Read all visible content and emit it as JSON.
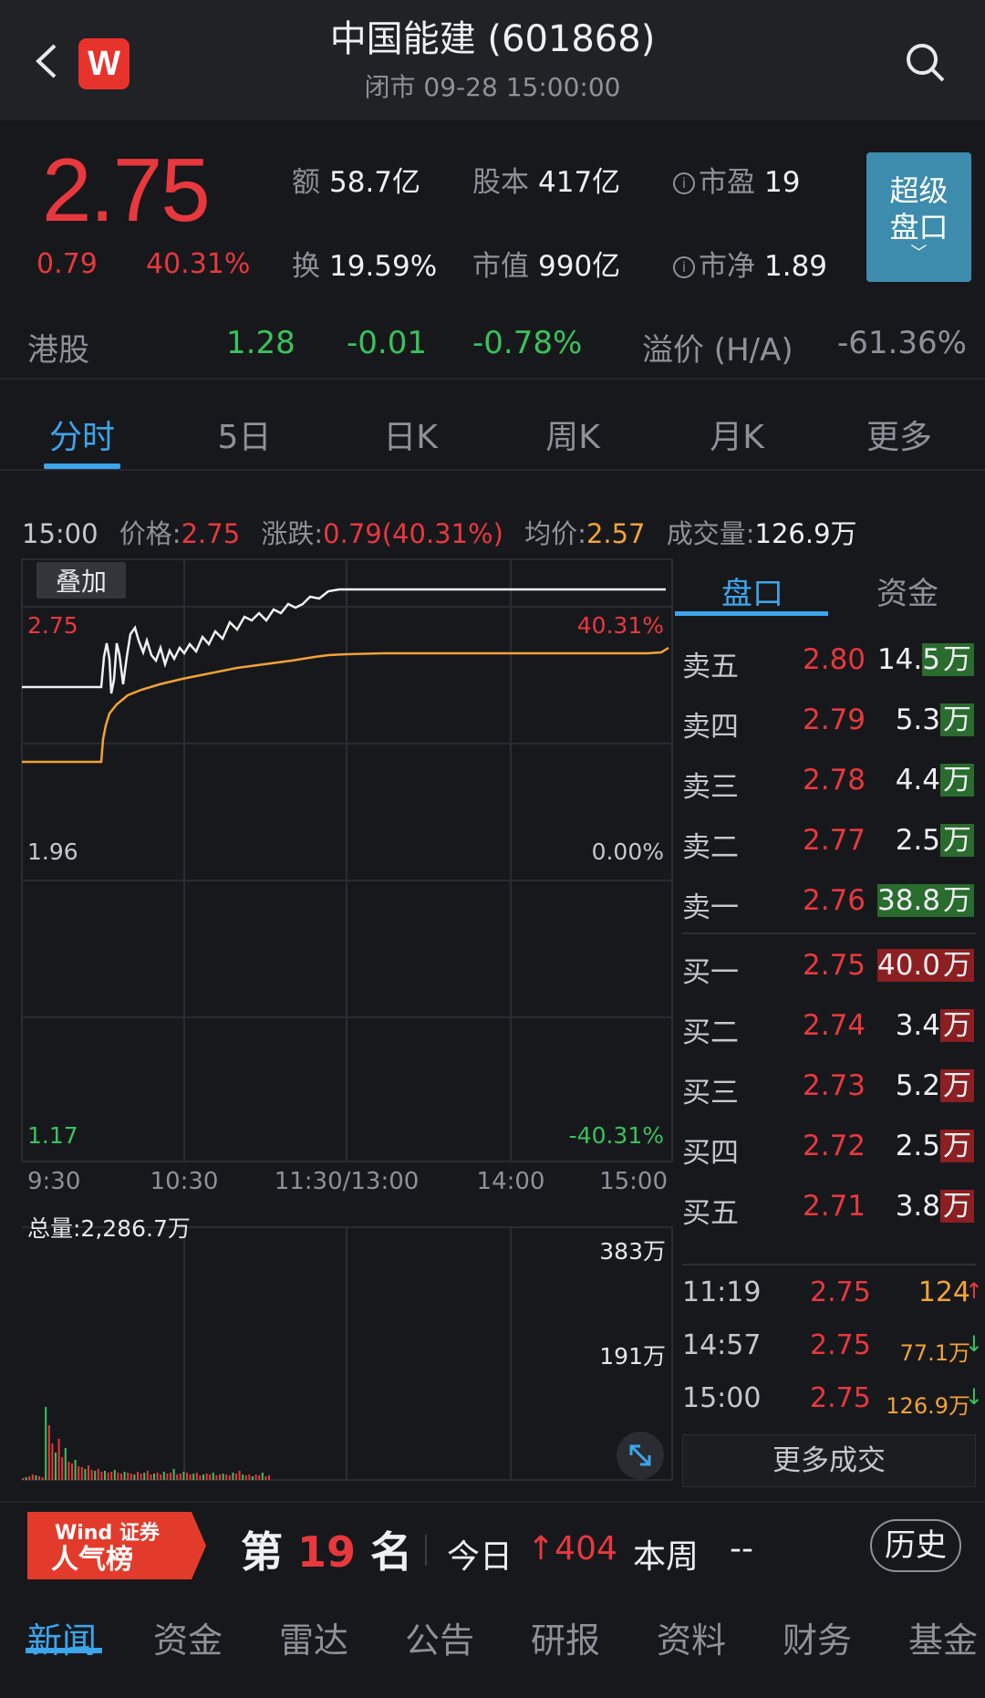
{
  "header": {
    "title": "中国能建 (601868)",
    "status": "闭市 09-28 15:00:00",
    "logo_letter": "W"
  },
  "quote": {
    "price": "2.75",
    "change": "0.79",
    "change_pct": "40.31%",
    "amount_label": "额",
    "amount": "58.7亿",
    "shares_label": "股本",
    "shares": "417亿",
    "pe_label": "市盈",
    "pe": "19",
    "turnover_label": "换",
    "turnover": "19.59%",
    "mcap_label": "市值",
    "mcap": "990亿",
    "pb_label": "市净",
    "pb": "1.89",
    "super_btn": [
      "超级",
      "盘口"
    ]
  },
  "hk": {
    "label": "港股",
    "price": "1.28",
    "change": "-0.01",
    "change_pct": "-0.78%",
    "premium_label": "溢价 (H/A)",
    "premium": "-61.36%"
  },
  "chart_tabs": [
    "分时",
    "5日",
    "日K",
    "周K",
    "月K",
    "更多"
  ],
  "info": {
    "time": "15:00",
    "price_label": "价格:",
    "price": "2.75",
    "chg_label": "涨跌:",
    "chg": "0.79(40.31%)",
    "avg_label": "均价:",
    "avg": "2.57",
    "vol_label": "成交量:",
    "vol": "126.9万"
  },
  "chart": {
    "overlay_btn": "叠加",
    "y_top": "2.75",
    "y_mid": "1.96",
    "y_bot": "1.17",
    "pct_top": "40.31%",
    "pct_mid": "0.00%",
    "pct_bot": "-40.31%",
    "x_ticks": [
      "9:30",
      "10:30",
      "11:30/13:00",
      "14:00",
      "15:00"
    ],
    "total_vol": "总量:2,286.7万",
    "vol_top": "383万",
    "vol_mid": "191万"
  },
  "chart_data": {
    "type": "line",
    "ylim": [
      1.17,
      2.75
    ],
    "series": [],
    "volume": {
      "ylim": [
        0,
        383
      ]
    }
  },
  "book": {
    "tabs": [
      "盘口",
      "资金"
    ],
    "asks": [
      {
        "level": "卖五",
        "price": "2.80",
        "qty_num": "14.",
        "qty_bar": "5",
        "unit": "万"
      },
      {
        "level": "卖四",
        "price": "2.79",
        "qty_num": "5.3",
        "qty_bar": "",
        "unit": "万"
      },
      {
        "level": "卖三",
        "price": "2.78",
        "qty_num": "4.4",
        "qty_bar": "",
        "unit": "万"
      },
      {
        "level": "卖二",
        "price": "2.77",
        "qty_num": "2.5",
        "qty_bar": "",
        "unit": "万"
      },
      {
        "level": "卖一",
        "price": "2.76",
        "qty_num": "",
        "qty_bar": "38.8",
        "unit": "万"
      }
    ],
    "bids": [
      {
        "level": "买一",
        "price": "2.75",
        "qty_num": "",
        "qty_bar": "40.0",
        "unit": "万"
      },
      {
        "level": "买二",
        "price": "2.74",
        "qty_num": "3.4",
        "qty_bar": "",
        "unit": "万"
      },
      {
        "level": "买三",
        "price": "2.73",
        "qty_num": "5.2",
        "qty_bar": "",
        "unit": "万"
      },
      {
        "level": "买四",
        "price": "2.72",
        "qty_num": "2.5",
        "qty_bar": "",
        "unit": "万"
      },
      {
        "level": "买五",
        "price": "2.71",
        "qty_num": "3.8",
        "qty_bar": "",
        "unit": "万"
      }
    ],
    "trades": [
      {
        "time": "11:19",
        "price": "2.75",
        "vol": "124",
        "dir": "↑"
      },
      {
        "time": "14:57",
        "price": "2.75",
        "vol": "77.1万",
        "dir": "↓"
      },
      {
        "time": "15:00",
        "price": "2.75",
        "vol": "126.9万",
        "dir": "↓"
      }
    ],
    "more_trades": "更多成交"
  },
  "rank": {
    "badge_top": "Wind 证券",
    "badge_bottom": "人气榜",
    "prefix": "第",
    "number": "19",
    "suffix": "名",
    "today_label": "今日",
    "today_value": "↑404",
    "week_label": "本周",
    "week_value": "--",
    "history_btn": "历史"
  },
  "bottom_tabs": [
    "新闻",
    "资金",
    "雷达",
    "公告",
    "研报",
    "资料",
    "财务",
    "基金"
  ]
}
